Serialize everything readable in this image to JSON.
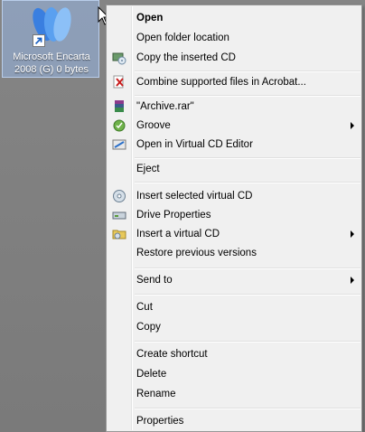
{
  "desktop_icon": {
    "label_line1": "Microsoft Encarta",
    "label_line2": "2008 (G) 0 bytes"
  },
  "menu": {
    "items": [
      {
        "label": "Open",
        "icon": "none",
        "bold": true
      },
      {
        "label": "Open folder location",
        "icon": "none"
      },
      {
        "label": "Copy the inserted CD",
        "icon": "copy-cd-icon"
      },
      {
        "label": "Combine supported files in Acrobat...",
        "icon": "acrobat-icon"
      },
      {
        "label": "\"Archive.rar\"",
        "icon": "winrar-icon"
      },
      {
        "label": "Groove",
        "icon": "groove-icon",
        "submenu": true
      },
      {
        "label": "Open in Virtual CD Editor",
        "icon": "virtual-cd-editor-icon"
      },
      {
        "label": "Eject",
        "icon": "none"
      },
      {
        "label": "Insert selected virtual CD",
        "icon": "insert-virtual-cd-icon"
      },
      {
        "label": "Drive Properties",
        "icon": "drive-properties-icon"
      },
      {
        "label": "Insert a virtual CD",
        "icon": "insert-cd-folder-icon",
        "submenu": true
      },
      {
        "label": "Restore previous versions",
        "icon": "none"
      },
      {
        "label": "Send to",
        "icon": "none",
        "submenu": true
      },
      {
        "label": "Cut",
        "icon": "none"
      },
      {
        "label": "Copy",
        "icon": "none"
      },
      {
        "label": "Create shortcut",
        "icon": "none"
      },
      {
        "label": "Delete",
        "icon": "none"
      },
      {
        "label": "Rename",
        "icon": "none"
      },
      {
        "label": "Properties",
        "icon": "none"
      }
    ]
  },
  "colors": {
    "desktop_bg": "#7f7f7f",
    "menu_bg": "#f0f0f0",
    "selection": "#96b4e1"
  }
}
